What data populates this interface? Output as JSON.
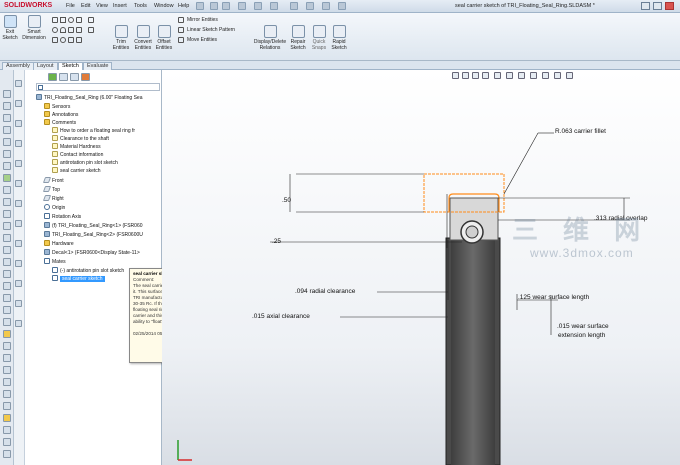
{
  "app": {
    "name": "SOLIDWORKS",
    "doc_title": "seal carrier sketch of TRI_Floating_Seal_Ring.SLDASM *"
  },
  "menu": [
    "File",
    "Edit",
    "View",
    "Insert",
    "Tools",
    "Window",
    "Help"
  ],
  "ribbon": {
    "exit_sketch": "Exit Sketch",
    "smart_dimension": "Smart Dimension",
    "trim_entities": "Trim Entities",
    "convert_entities": "Convert Entities",
    "offset_entities": "Offset Entities",
    "mirror_entities": "Mirror Entities",
    "linear_sketch_pattern": "Linear Sketch Pattern",
    "move_entities": "Move Entities",
    "display_delete_relations": "Display/Delete Relations",
    "repair_sketch": "Repair Sketch",
    "quick_snaps": "Quick Snaps",
    "rapid_sketch": "Rapid Sketch"
  },
  "tabs": [
    "Assembly",
    "Layout",
    "Sketch",
    "Evaluate"
  ],
  "active_tab": "Sketch",
  "tree": {
    "root": "TRI_Floating_Seal_Ring  (6.00\" Floating Sea",
    "items": [
      "Sensors",
      "Annotations",
      "Comments",
      "How to order a floating seal ring fr",
      "Clearance to the shaft",
      "Material Hardness",
      "Contact information",
      "antirotation pin slot sketch",
      "seal carrier sketch",
      "Front",
      "Top",
      "Right",
      "Origin",
      "Rotation Axis",
      "(f) TRI_Floating_Seal_Ring<1> (FSR060",
      "TRI_Floating_Seal_Ring<2> (FSR0600U",
      "Hardware",
      "Decal<1> (FSR0600<Display State-11>",
      "Mates",
      "(-) antirotation pin slot sketch",
      "seal carrier sketch"
    ]
  },
  "tooltip": {
    "title": "seal carrier sketch",
    "label": "Comment:",
    "body": "The seal carrier groove has a wear surface on it. This surface should be softer than the seal. TRI manufactures seals with a hardness from 30-35 Rc. If the wear surface is not present, the floating seal ring will make a groove in the seal carrier and this groove will restrict the seals ability to \"float\".",
    "footer": "02/25/2014 05:54 PM  mark.simonelli"
  },
  "dimensions": {
    "fillet": "R.063 carrier fillet",
    "d50": ".50",
    "d25": ".25",
    "radial_overlap": ".313 radial overlap",
    "radial_clearance": ".094 radial clearance",
    "wear_surface_length": ".125 wear surface length",
    "axial_clearance": ".015 axial clearance",
    "wear_ext_1": ".015 wear surface",
    "wear_ext_2": "extension length"
  },
  "watermark": {
    "cn": "三 维 网",
    "url": "www.3dmox.com"
  }
}
